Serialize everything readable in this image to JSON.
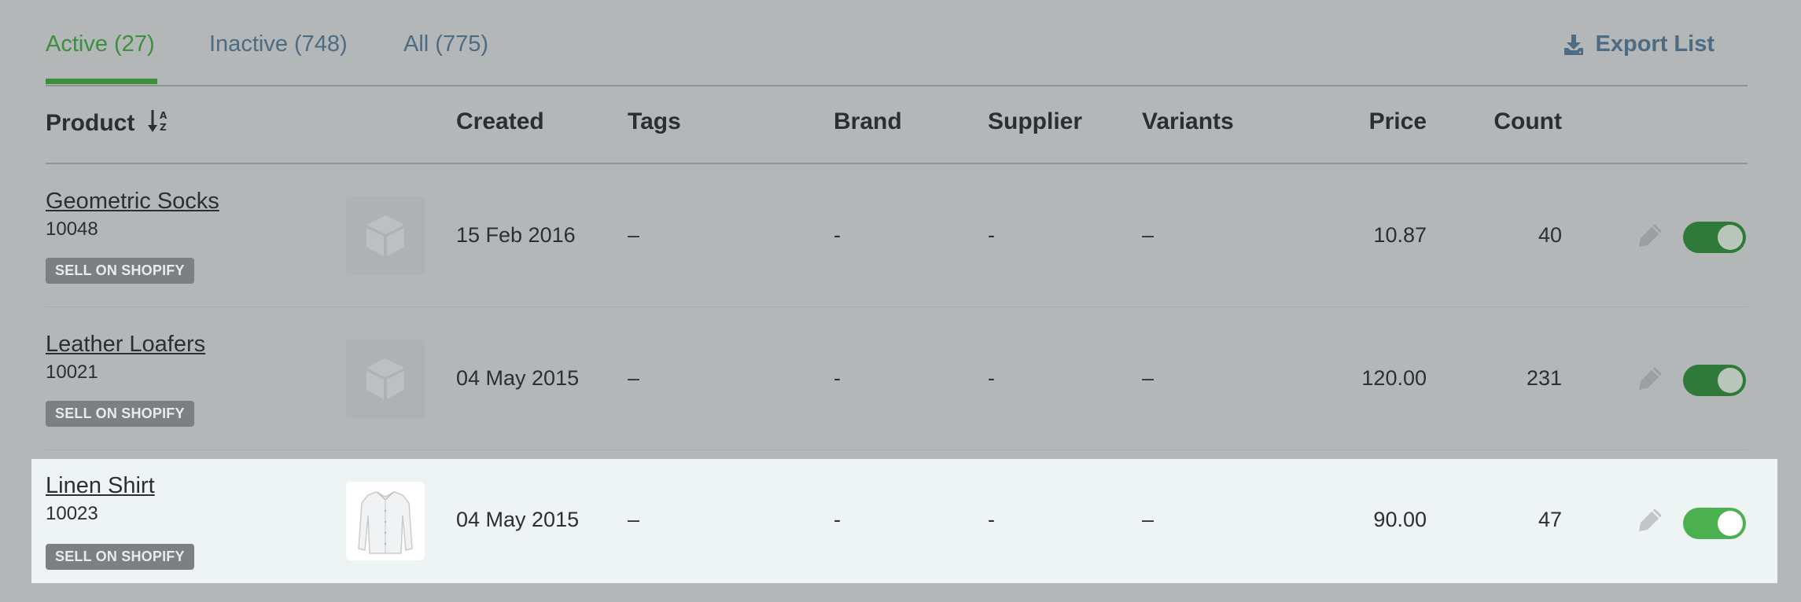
{
  "tabs": [
    {
      "label": "Active (27)"
    },
    {
      "label": "Inactive (748)"
    },
    {
      "label": "All (775)"
    }
  ],
  "export": {
    "label": "Export List",
    "icon": "download-icon"
  },
  "columns": {
    "product": "Product",
    "created": "Created",
    "tags": "Tags",
    "brand": "Brand",
    "supplier": "Supplier",
    "variants": "Variants",
    "price": "Price",
    "count": "Count"
  },
  "sort_icon": "sort-alpha-down-icon",
  "rows": [
    {
      "name": "Geometric Socks",
      "sku": "10048",
      "badge": "SELL ON SHOPIFY",
      "image": "placeholder-box-icon",
      "created": "15 Feb 2016",
      "tags": "–",
      "brand": "-",
      "supplier": "-",
      "variants": "–",
      "price": "10.87",
      "count": "40",
      "active": true
    },
    {
      "name": "Leather Loafers",
      "sku": "10021",
      "badge": "SELL ON SHOPIFY",
      "image": "placeholder-box-icon",
      "created": "04 May 2015",
      "tags": "–",
      "brand": "-",
      "supplier": "-",
      "variants": "–",
      "price": "120.00",
      "count": "231",
      "active": true
    },
    {
      "name": "Linen Shirt",
      "sku": "10023",
      "badge": "SELL ON SHOPIFY",
      "image": "shirt-image",
      "created": "04 May 2015",
      "tags": "–",
      "brand": "-",
      "supplier": "-",
      "variants": "–",
      "price": "90.00",
      "count": "47",
      "active": true
    }
  ],
  "colors": {
    "accent_green": "#3b8f3d",
    "link_blue": "#4d6b82",
    "toggle_dim": "#2f7a38",
    "toggle_bright": "#4caf50",
    "highlight_row": "#eef3f3"
  }
}
